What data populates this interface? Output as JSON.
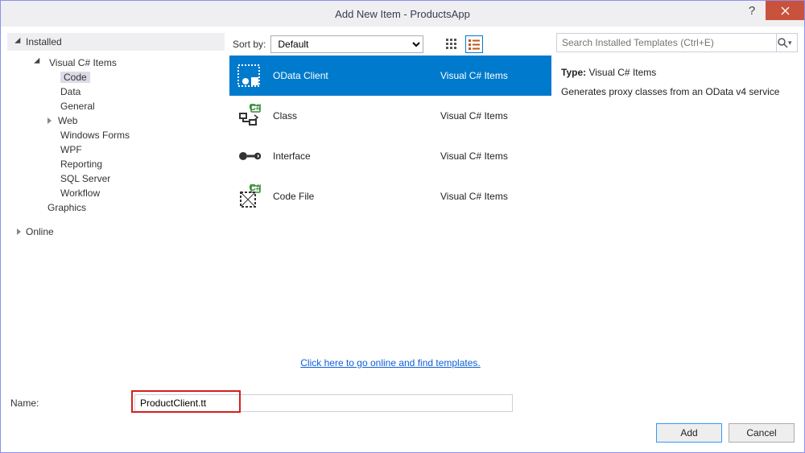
{
  "window": {
    "title": "Add New Item - ProductsApp"
  },
  "left": {
    "installed": "Installed",
    "online": "Online",
    "tree": {
      "root": "Visual C# Items",
      "items": [
        "Code",
        "Data",
        "General",
        "Web",
        "Windows Forms",
        "WPF",
        "Reporting",
        "SQL Server",
        "Workflow"
      ],
      "root2": "Graphics",
      "selected": "Code",
      "webExpandable": "Web"
    }
  },
  "mid": {
    "sortLabel": "Sort by:",
    "sortValue": "Default",
    "items": [
      {
        "name": "OData Client",
        "cat": "Visual C# Items",
        "selected": true
      },
      {
        "name": "Class",
        "cat": "Visual C# Items",
        "selected": false
      },
      {
        "name": "Interface",
        "cat": "Visual C# Items",
        "selected": false
      },
      {
        "name": "Code File",
        "cat": "Visual C# Items",
        "selected": false
      }
    ],
    "link": "Click here to go online and find templates."
  },
  "right": {
    "searchPlaceholder": "Search Installed Templates (Ctrl+E)",
    "typeLabel": "Type:",
    "typeValue": "Visual C# Items",
    "desc": "Generates proxy classes from an OData v4 service"
  },
  "bottom": {
    "nameLabel": "Name:",
    "nameValue": "ProductClient.tt",
    "add": "Add",
    "cancel": "Cancel"
  }
}
